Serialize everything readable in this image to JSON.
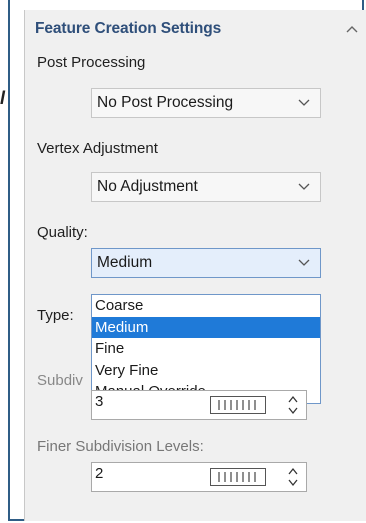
{
  "panel": {
    "title": "Feature Creation Settings"
  },
  "post_processing": {
    "label": "Post Processing",
    "value": "No Post Processing"
  },
  "vertex_adjustment": {
    "label": "Vertex Adjustment",
    "value": "No Adjustment"
  },
  "quality": {
    "label": "Quality:",
    "value": "Medium",
    "options": [
      "Coarse",
      "Medium",
      "Fine",
      "Very Fine",
      "Manual Override"
    ],
    "selected_index": 1
  },
  "type": {
    "label": "Type:"
  },
  "subdivision": {
    "label": "Subdiv",
    "value": "3"
  },
  "finer_subdivision": {
    "label": "Finer Subdivision Levels:",
    "value": "2"
  },
  "stray_mark": "l",
  "colors": {
    "title": "#2f4f7a",
    "selected_option": "#1f7ad8",
    "frame": "#2f5d86"
  }
}
